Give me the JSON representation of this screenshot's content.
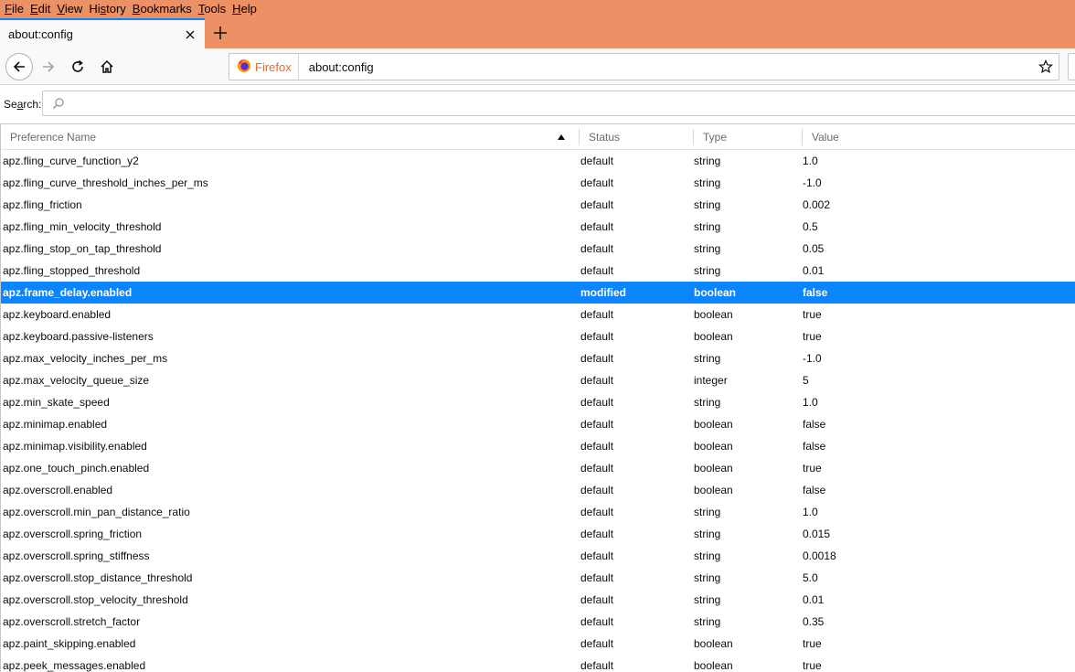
{
  "menubar": {
    "items": [
      {
        "key": "F",
        "rest": "ile"
      },
      {
        "key": "E",
        "rest": "dit"
      },
      {
        "key": "V",
        "rest": "iew"
      },
      {
        "pre": "Hi",
        "key": "s",
        "rest": "tory"
      },
      {
        "key": "B",
        "rest": "ookmarks"
      },
      {
        "key": "T",
        "rest": "ools"
      },
      {
        "key": "H",
        "rest": "elp"
      }
    ]
  },
  "tab": {
    "title": "about:config"
  },
  "urlbar": {
    "identity_label": "Firefox",
    "url": "about:config"
  },
  "search": {
    "label_pre": "Se",
    "label_key": "a",
    "label_rest": "rch:",
    "value": ""
  },
  "columns": {
    "name": "Preference Name",
    "status": "Status",
    "type": "Type",
    "value": "Value"
  },
  "rows": [
    {
      "name": "apz.fling_curve_function_y2",
      "status": "default",
      "type": "string",
      "value": "1.0"
    },
    {
      "name": "apz.fling_curve_threshold_inches_per_ms",
      "status": "default",
      "type": "string",
      "value": "-1.0"
    },
    {
      "name": "apz.fling_friction",
      "status": "default",
      "type": "string",
      "value": "0.002"
    },
    {
      "name": "apz.fling_min_velocity_threshold",
      "status": "default",
      "type": "string",
      "value": "0.5"
    },
    {
      "name": "apz.fling_stop_on_tap_threshold",
      "status": "default",
      "type": "string",
      "value": "0.05"
    },
    {
      "name": "apz.fling_stopped_threshold",
      "status": "default",
      "type": "string",
      "value": "0.01"
    },
    {
      "name": "apz.frame_delay.enabled",
      "status": "modified",
      "type": "boolean",
      "value": "false",
      "selected": true
    },
    {
      "name": "apz.keyboard.enabled",
      "status": "default",
      "type": "boolean",
      "value": "true"
    },
    {
      "name": "apz.keyboard.passive-listeners",
      "status": "default",
      "type": "boolean",
      "value": "true"
    },
    {
      "name": "apz.max_velocity_inches_per_ms",
      "status": "default",
      "type": "string",
      "value": "-1.0"
    },
    {
      "name": "apz.max_velocity_queue_size",
      "status": "default",
      "type": "integer",
      "value": "5"
    },
    {
      "name": "apz.min_skate_speed",
      "status": "default",
      "type": "string",
      "value": "1.0"
    },
    {
      "name": "apz.minimap.enabled",
      "status": "default",
      "type": "boolean",
      "value": "false"
    },
    {
      "name": "apz.minimap.visibility.enabled",
      "status": "default",
      "type": "boolean",
      "value": "false"
    },
    {
      "name": "apz.one_touch_pinch.enabled",
      "status": "default",
      "type": "boolean",
      "value": "true"
    },
    {
      "name": "apz.overscroll.enabled",
      "status": "default",
      "type": "boolean",
      "value": "false"
    },
    {
      "name": "apz.overscroll.min_pan_distance_ratio",
      "status": "default",
      "type": "string",
      "value": "1.0"
    },
    {
      "name": "apz.overscroll.spring_friction",
      "status": "default",
      "type": "string",
      "value": "0.015"
    },
    {
      "name": "apz.overscroll.spring_stiffness",
      "status": "default",
      "type": "string",
      "value": "0.0018"
    },
    {
      "name": "apz.overscroll.stop_distance_threshold",
      "status": "default",
      "type": "string",
      "value": "5.0"
    },
    {
      "name": "apz.overscroll.stop_velocity_threshold",
      "status": "default",
      "type": "string",
      "value": "0.01"
    },
    {
      "name": "apz.overscroll.stretch_factor",
      "status": "default",
      "type": "string",
      "value": "0.35"
    },
    {
      "name": "apz.paint_skipping.enabled",
      "status": "default",
      "type": "boolean",
      "value": "true"
    },
    {
      "name": "apz.peek_messages.enabled",
      "status": "default",
      "type": "boolean",
      "value": "true"
    }
  ],
  "colors": {
    "chrome": "#ec9065",
    "accent": "#0a84ff",
    "firefox_label": "#e56a28"
  },
  "icons": {
    "close": "close-icon",
    "plus": "plus-icon",
    "back": "back-arrow-icon",
    "forward": "forward-arrow-icon",
    "reload": "reload-icon",
    "home": "home-icon",
    "firefox": "firefox-logo-icon",
    "star": "bookmark-star-icon",
    "search": "search-icon",
    "sort": "sort-ascending-icon"
  }
}
